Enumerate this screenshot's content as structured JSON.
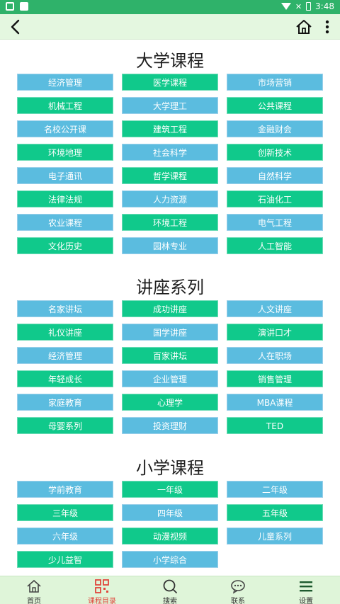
{
  "status_bar": {
    "time": "3:48"
  },
  "icons": {
    "back": "back-arrow-icon",
    "home": "home-icon",
    "more": "more-vertical-icon"
  },
  "sections": [
    {
      "title": "大学课程",
      "items": [
        "经济管理",
        "医学课程",
        "市场营销",
        "机械工程",
        "大学理工",
        "公共课程",
        "名校公开课",
        "建筑工程",
        "金融财会",
        "环境地理",
        "社会科学",
        "创新技术",
        "电子通讯",
        "哲学课程",
        "自然科学",
        "法律法规",
        "人力资源",
        "石油化工",
        "农业课程",
        "环境工程",
        "电气工程",
        "文化历史",
        "园林专业",
        "人工智能"
      ]
    },
    {
      "title": "讲座系列",
      "items": [
        "名家讲坛",
        "成功讲座",
        "人文讲座",
        "礼仪讲座",
        "国学讲座",
        "演讲口才",
        "经济管理",
        "百家讲坛",
        "人在职场",
        "年轻成长",
        "企业管理",
        "销售管理",
        "家庭教育",
        "心理学",
        "MBA课程",
        "母婴系列",
        "投资理财",
        "TED"
      ]
    },
    {
      "title": "小学课程",
      "items": [
        "学前教育",
        "一年级",
        "二年级",
        "三年级",
        "四年级",
        "五年级",
        "六年级",
        "动漫视频",
        "儿童系列",
        "少儿益智",
        "小学综合"
      ]
    }
  ],
  "tab_bar": [
    {
      "label": "首页",
      "icon": "home-icon"
    },
    {
      "label": "课程目录",
      "icon": "qr-grid-icon",
      "active": true
    },
    {
      "label": "搜索",
      "icon": "search-icon"
    },
    {
      "label": "联系",
      "icon": "chat-bubble-icon"
    },
    {
      "label": "设置",
      "icon": "menu-lines-icon"
    }
  ],
  "colors": {
    "status_bar": "#2fb26a",
    "app_bar": "#e4f7e0",
    "tag_blue": "#5bbcdf",
    "tag_green": "#10c98b",
    "tab_active": "#e0463c"
  }
}
